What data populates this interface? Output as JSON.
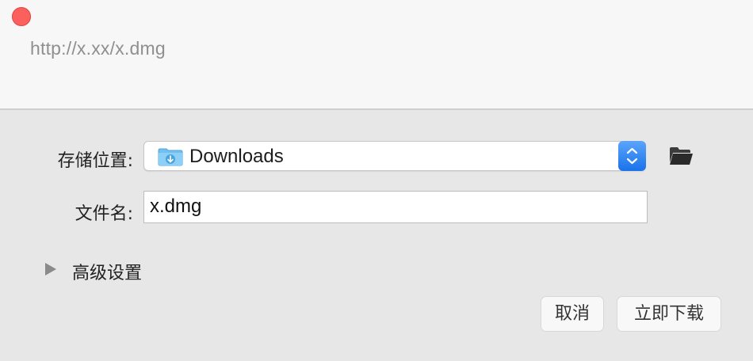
{
  "window": {
    "url": "http://x.xx/x.dmg"
  },
  "form": {
    "location_label": "存储位置:",
    "location_value": "Downloads",
    "filename_label": "文件名:",
    "filename_value": "x.dmg"
  },
  "advanced": {
    "label": "高级设置"
  },
  "buttons": {
    "cancel": "取消",
    "download": "立即下载"
  },
  "icons": {
    "close": "close-icon",
    "folder": "downloads-folder-icon",
    "stepper": "stepper-updown-icon",
    "browse": "folder-icon",
    "disclosure": "disclosure-triangle-icon"
  },
  "colors": {
    "close": "#fc605c",
    "accent": "#2a7ff0",
    "folder": "#7ec8f4"
  }
}
